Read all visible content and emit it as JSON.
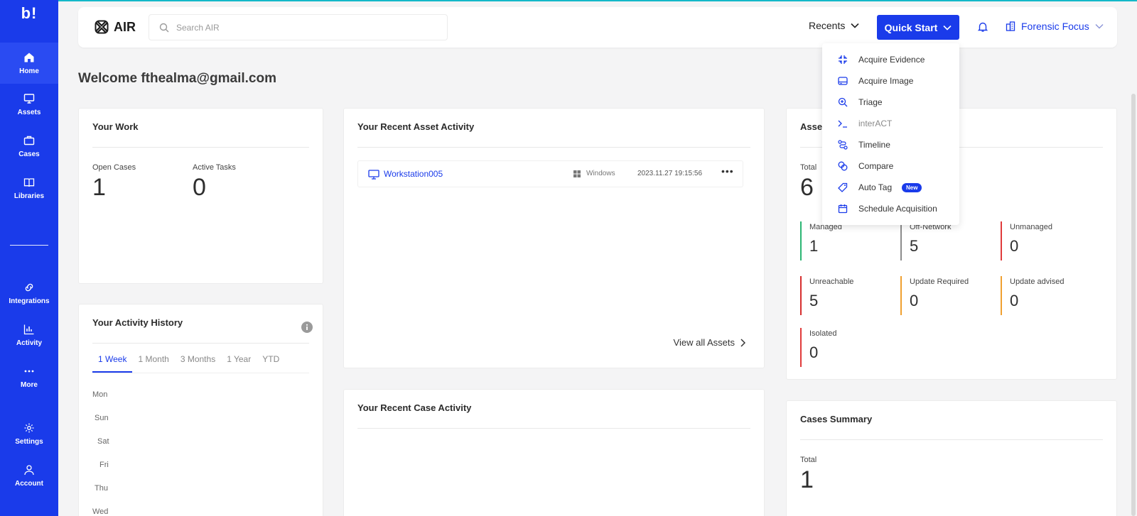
{
  "sidebar": {
    "logo": "b!",
    "items": [
      {
        "label": "Home",
        "icon": "home-icon"
      },
      {
        "label": "Assets",
        "icon": "monitor-icon"
      },
      {
        "label": "Cases",
        "icon": "briefcase-icon"
      },
      {
        "label": "Libraries",
        "icon": "book-icon"
      },
      {
        "label": "Integrations",
        "icon": "link-icon"
      },
      {
        "label": "Activity",
        "icon": "bar-chart-icon"
      },
      {
        "label": "More",
        "icon": "more-dots-icon"
      },
      {
        "label": "Settings",
        "icon": "gear-icon"
      },
      {
        "label": "Account",
        "icon": "user-icon"
      }
    ],
    "active": "Home",
    "accent": "#1a3bea"
  },
  "header": {
    "brand": "AIR",
    "search_placeholder": "Search AIR",
    "recents": "Recents",
    "quick_start": "Quick Start",
    "organization": "Forensic Focus"
  },
  "quick_start_menu": [
    {
      "label": "Acquire Evidence",
      "icon": "acquire-evidence-icon"
    },
    {
      "label": "Acquire Image",
      "icon": "disk-image-icon"
    },
    {
      "label": "Triage",
      "icon": "triage-search-icon"
    },
    {
      "label": "interACT",
      "icon": "terminal-icon"
    },
    {
      "label": "Timeline",
      "icon": "timeline-icon"
    },
    {
      "label": "Compare",
      "icon": "compare-icon"
    },
    {
      "label": "Auto Tag",
      "icon": "tag-icon",
      "badge": "New"
    },
    {
      "label": "Schedule Acquisition",
      "icon": "calendar-icon"
    }
  ],
  "welcome": "Welcome fthealma@gmail.com",
  "your_work": {
    "title": "Your Work",
    "open_cases_label": "Open Cases",
    "open_cases": "1",
    "active_tasks_label": "Active Tasks",
    "active_tasks": "0"
  },
  "activity_history": {
    "title": "Your Activity History",
    "tabs": [
      "1 Week",
      "1 Month",
      "3 Months",
      "1 Year",
      "YTD"
    ],
    "active_tab": "1 Week",
    "days": [
      "Mon",
      "Sun",
      "Sat",
      "Fri",
      "Thu",
      "Wed"
    ]
  },
  "recent_asset_activity": {
    "title": "Your Recent Asset Activity",
    "rows": [
      {
        "name": "Workstation005",
        "os": "Windows",
        "timestamp": "2023.11.27 19:15:56"
      }
    ],
    "view_all": "View all Assets"
  },
  "recent_case_activity": {
    "title": "Your Recent Case Activity"
  },
  "assets_summary": {
    "title": "Asse",
    "total_label": "Total",
    "total": "6",
    "statuses": [
      {
        "label": "Managed",
        "value": "1",
        "color": "#2bb673"
      },
      {
        "label": "Off-Network",
        "value": "5",
        "color": "#8c8c8c"
      },
      {
        "label": "Unmanaged",
        "value": "0",
        "color": "#e03b3b"
      },
      {
        "label": "Unreachable",
        "value": "5",
        "color": "#d62e2e"
      },
      {
        "label": "Update Required",
        "value": "0",
        "color": "#f0a030"
      },
      {
        "label": "Update advised",
        "value": "0",
        "color": "#f0a030"
      },
      {
        "label": "Isolated",
        "value": "0",
        "color": "#e03b3b"
      }
    ]
  },
  "cases_summary": {
    "title": "Cases Summary",
    "total_label": "Total",
    "total": "1"
  }
}
